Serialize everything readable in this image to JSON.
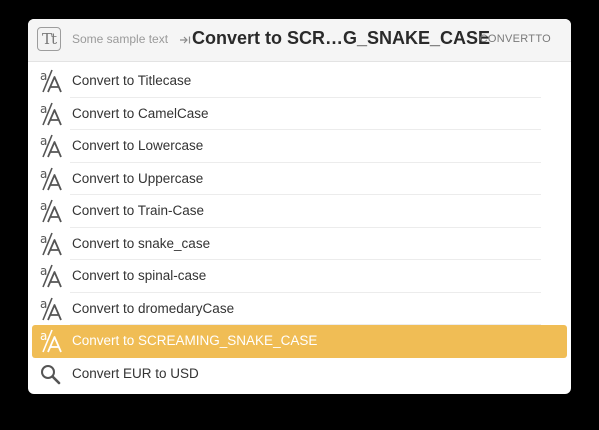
{
  "header": {
    "app_icon": "text-tool-icon",
    "app_icon_glyph": "Tt",
    "input_text": "Some sample text",
    "tab_icon": "tab-arrow-icon",
    "title": "Convert to SCR…G_SNAKE_CASE",
    "action_name": "CONVERTTO"
  },
  "results": [
    {
      "label": "Convert to Titlecase",
      "icon": "case-convert-icon",
      "selected": false
    },
    {
      "label": "Convert to CamelCase",
      "icon": "case-convert-icon",
      "selected": false
    },
    {
      "label": "Convert to Lowercase",
      "icon": "case-convert-icon",
      "selected": false
    },
    {
      "label": "Convert to Uppercase",
      "icon": "case-convert-icon",
      "selected": false
    },
    {
      "label": "Convert to Train-Case",
      "icon": "case-convert-icon",
      "selected": false
    },
    {
      "label": "Convert to snake_case",
      "icon": "case-convert-icon",
      "selected": false
    },
    {
      "label": "Convert to spinal-case",
      "icon": "case-convert-icon",
      "selected": false
    },
    {
      "label": "Convert to dromedaryCase",
      "icon": "case-convert-icon",
      "selected": false
    },
    {
      "label": "Convert to SCREAMING_SNAKE_CASE",
      "icon": "case-convert-icon",
      "selected": true
    },
    {
      "label": "Convert EUR to USD",
      "icon": "magnifier-icon",
      "selected": false
    }
  ],
  "colors": {
    "selection": "#f0bd55",
    "background": "#000000",
    "panel": "#ffffff"
  }
}
